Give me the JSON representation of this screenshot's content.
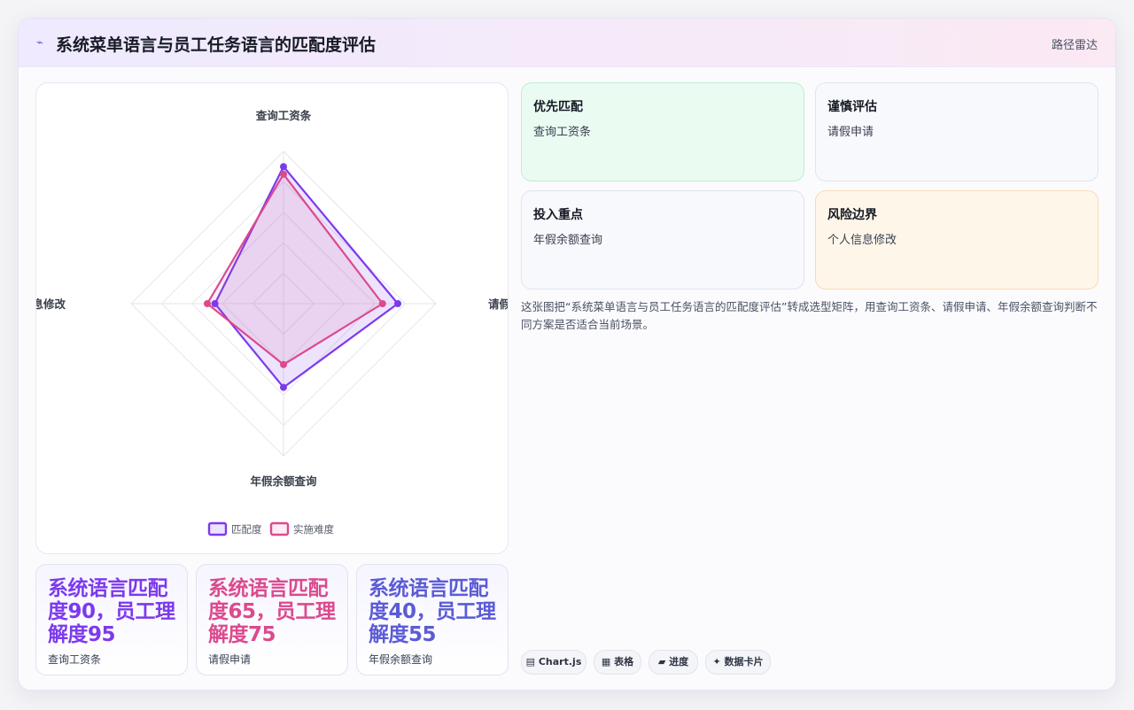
{
  "header": {
    "icon": "pulse-icon",
    "title": "系统菜单语言与员工任务语言的匹配度评估",
    "tag": "路径雷达"
  },
  "chart_data": {
    "type": "radar",
    "axes": [
      "查询工资条",
      "请假申请",
      "年假余额查询",
      "个人信息修改"
    ],
    "series": [
      {
        "name": "匹配度",
        "values": [
          90,
          75,
          55,
          45
        ],
        "color": "#7c3aed"
      },
      {
        "name": "实施难度",
        "values": [
          85,
          65,
          40,
          50
        ],
        "color": "#db4a8e"
      }
    ],
    "range": [
      0,
      100
    ],
    "rings": 5,
    "legend_position": "bottom"
  },
  "stats": [
    {
      "text": "系统语言匹配度90，员工理解度95",
      "label": "查询工资条",
      "color": "#7c3aed"
    },
    {
      "text": "系统语言匹配度65，员工理解度75",
      "label": "请假申请",
      "color": "#db4a8e"
    },
    {
      "text": "系统语言匹配度40，员工理解度55",
      "label": "年假余额查询",
      "color": "#5b5bd6"
    }
  ],
  "matrix": [
    {
      "title": "优先匹配",
      "value": "查询工资条"
    },
    {
      "title": "谨慎评估",
      "value": "请假申请"
    },
    {
      "title": "投入重点",
      "value": "年假余额查询"
    },
    {
      "title": "风险边界",
      "value": "个人信息修改"
    }
  ],
  "description": "这张图把“系统菜单语言与员工任务语言的匹配度评估”转成选型矩阵，用查询工资条、请假申请、年假余额查询判断不同方案是否适合当前场景。",
  "chips": [
    {
      "icon": "chart-icon",
      "glyph": "▤",
      "label": "Chart.js"
    },
    {
      "icon": "table-icon",
      "glyph": "▦",
      "label": "表格"
    },
    {
      "icon": "progress-icon",
      "glyph": "▰",
      "label": "进度"
    },
    {
      "icon": "sparkle-icon",
      "glyph": "✦",
      "label": "数据卡片"
    }
  ]
}
